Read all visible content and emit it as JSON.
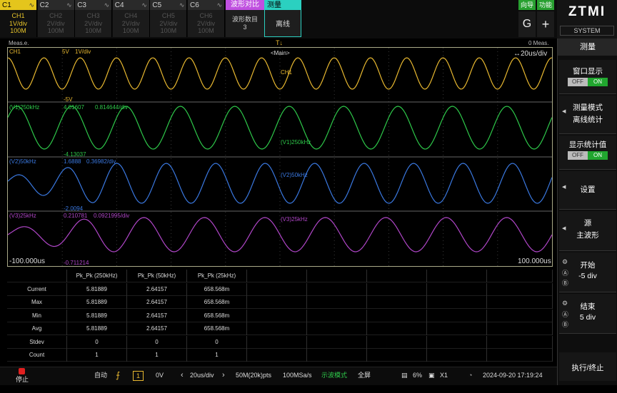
{
  "channels": [
    {
      "id": "C1",
      "label": "CH1",
      "scale": "1V/div",
      "depth": "100M",
      "active": true
    },
    {
      "id": "C2",
      "label": "CH2",
      "scale": "2V/div",
      "depth": "100M",
      "active": false
    },
    {
      "id": "C3",
      "label": "CH3",
      "scale": "2V/div",
      "depth": "100M",
      "active": false
    },
    {
      "id": "C4",
      "label": "CH4",
      "scale": "2V/div",
      "depth": "100M",
      "active": false
    },
    {
      "id": "C5",
      "label": "CH5",
      "scale": "2V/div",
      "depth": "100M",
      "active": false
    },
    {
      "id": "C6",
      "label": "CH6",
      "scale": "2V/div",
      "depth": "100M",
      "active": false
    }
  ],
  "wave_compare": {
    "title": "波形对比",
    "line1": "波形数目",
    "line2": "3"
  },
  "measure_tab": {
    "title": "测量",
    "value": "离线"
  },
  "nav_button": "向导",
  "func_button": "功能",
  "g_button": "G",
  "plus_button": "+",
  "logo": {
    "brand": "ZTMI",
    "sub": "SYSTEM"
  },
  "subbar": {
    "left": "Meas.e.",
    "center": "T↓",
    "right": "0 Meas."
  },
  "scope": {
    "ch1_label": "CH1",
    "ch1_volts": "5V",
    "ch1_scale": "1V/div",
    "main_label": "<Main>",
    "timebase": "↔20us/div",
    "ch1_marker": "CH1",
    "ch1_min": "-5V",
    "v1_label": "(V1)250kHz",
    "v1_max": "4.01607",
    "v1_scale": "0.814644/div",
    "v1_marker": "(V1)250kHz",
    "v1_min": "-4.13037",
    "v2_label": "(V2)50kHz",
    "v2_max": "1.6888",
    "v2_scale": "0.36982/div",
    "v2_marker": "(V2)50kHz",
    "v2_min": "-2.0094",
    "v3_label": "(V3)25kHz",
    "v3_max": "0.210781",
    "v3_scale": "0.0921995/div",
    "v3_marker": "(V3)25kHz",
    "v3_min": "-0.711214",
    "time_left": "-100.000us",
    "time_right": "100.000us"
  },
  "colors": {
    "ch1": "#e8b830",
    "v1": "#2ec84a",
    "v2": "#3a78e0",
    "v3": "#b046c8",
    "grid": "#3a3a3a",
    "accent": "#2bd0c0"
  },
  "table": {
    "headers": [
      "",
      "Pk_Pk (250kHz)",
      "Pk_Pk (50kHz)",
      "Pk_Pk (25kHz)"
    ],
    "rows": [
      [
        "Current",
        "5.81889",
        "2.64157",
        "658.568m"
      ],
      [
        "Max",
        "5.81889",
        "2.64157",
        "658.568m"
      ],
      [
        "Min",
        "5.81889",
        "2.64157",
        "658.568m"
      ],
      [
        "Avg",
        "5.81889",
        "2.64157",
        "658.568m"
      ],
      [
        "Stdev",
        "0",
        "0",
        "0"
      ],
      [
        "Count",
        "1",
        "1",
        "1"
      ]
    ]
  },
  "right_panel": {
    "header": "测量",
    "window_display": "窗口显示",
    "toggle_off": "OFF",
    "toggle_on": "ON",
    "meas_mode": "测量模式",
    "meas_mode_val": "离线统计",
    "show_stats": "显示统计值",
    "settings": "设置",
    "source": "源",
    "source_val": "主波形",
    "start": "开始",
    "start_val": "-5 div",
    "end": "结束",
    "end_val": "5 div",
    "exec": "执行/终止"
  },
  "bottom": {
    "stop": "停止",
    "auto": "自动",
    "trig_ch": "1",
    "trig_level": "0V",
    "timebase": "20us/div",
    "points": "50M(20k)pts",
    "rate": "100MSa/s",
    "mode": "示波模式",
    "fullscreen": "全屏",
    "battery": "6%",
    "zoom": "X1",
    "datetime": "2024-09-20 17:19:24"
  },
  "waves": {
    "ch1_periods": 15,
    "v1_periods": 10,
    "v2_periods": 11,
    "v3_periods": 9
  }
}
